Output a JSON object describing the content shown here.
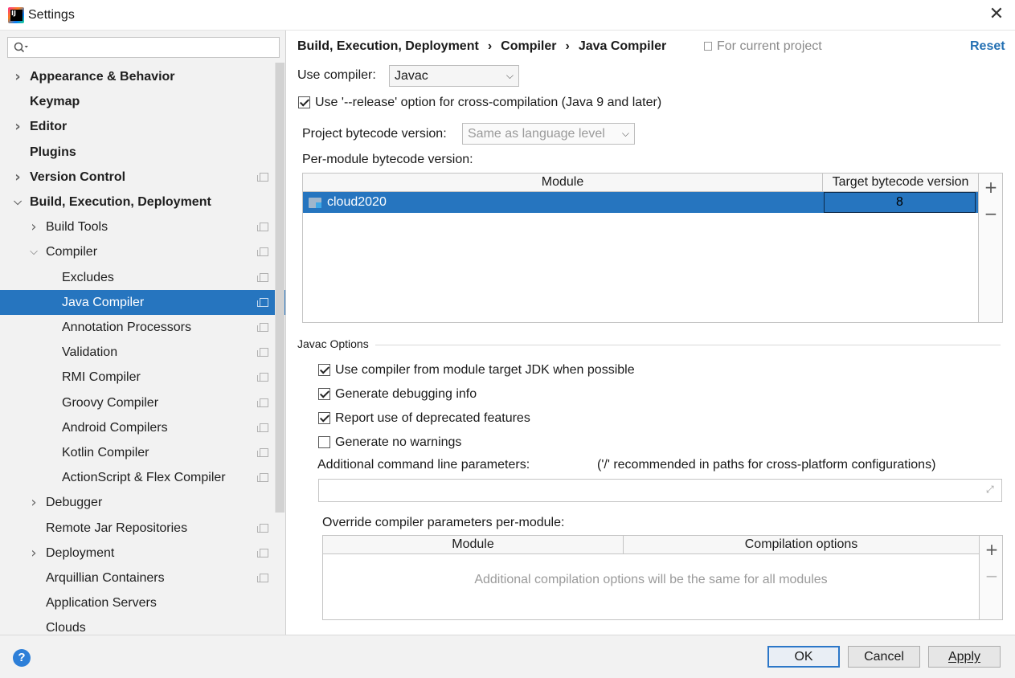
{
  "window": {
    "title": "Settings",
    "close": "✕"
  },
  "search": {
    "placeholder": ""
  },
  "sidebar": {
    "items": [
      {
        "label": "Appearance & Behavior",
        "bold": true,
        "chevron": "right",
        "level": 0,
        "copy": false,
        "selected": false
      },
      {
        "label": "Keymap",
        "bold": true,
        "chevron": "",
        "level": 0,
        "copy": false,
        "selected": false
      },
      {
        "label": "Editor",
        "bold": true,
        "chevron": "right",
        "level": 0,
        "copy": false,
        "selected": false
      },
      {
        "label": "Plugins",
        "bold": true,
        "chevron": "",
        "level": 0,
        "copy": false,
        "selected": false
      },
      {
        "label": "Version Control",
        "bold": true,
        "chevron": "right",
        "level": 0,
        "copy": true,
        "selected": false
      },
      {
        "label": "Build, Execution, Deployment",
        "bold": true,
        "chevron": "down",
        "level": 0,
        "copy": false,
        "selected": false
      },
      {
        "label": "Build Tools",
        "bold": false,
        "chevron": "right",
        "level": 1,
        "copy": true,
        "selected": false
      },
      {
        "label": "Compiler",
        "bold": false,
        "chevron": "down",
        "level": 1,
        "copy": true,
        "selected": false
      },
      {
        "label": "Excludes",
        "bold": false,
        "chevron": "",
        "level": 2,
        "copy": true,
        "selected": false
      },
      {
        "label": "Java Compiler",
        "bold": false,
        "chevron": "",
        "level": 2,
        "copy": true,
        "selected": true
      },
      {
        "label": "Annotation Processors",
        "bold": false,
        "chevron": "",
        "level": 2,
        "copy": true,
        "selected": false
      },
      {
        "label": "Validation",
        "bold": false,
        "chevron": "",
        "level": 2,
        "copy": true,
        "selected": false
      },
      {
        "label": "RMI Compiler",
        "bold": false,
        "chevron": "",
        "level": 2,
        "copy": true,
        "selected": false
      },
      {
        "label": "Groovy Compiler",
        "bold": false,
        "chevron": "",
        "level": 2,
        "copy": true,
        "selected": false
      },
      {
        "label": "Android Compilers",
        "bold": false,
        "chevron": "",
        "level": 2,
        "copy": true,
        "selected": false
      },
      {
        "label": "Kotlin Compiler",
        "bold": false,
        "chevron": "",
        "level": 2,
        "copy": true,
        "selected": false
      },
      {
        "label": "ActionScript & Flex Compiler",
        "bold": false,
        "chevron": "",
        "level": 2,
        "copy": true,
        "selected": false
      },
      {
        "label": "Debugger",
        "bold": false,
        "chevron": "right",
        "level": 1,
        "copy": false,
        "selected": false
      },
      {
        "label": "Remote Jar Repositories",
        "bold": false,
        "chevron": "",
        "level": 1,
        "copy": true,
        "selected": false
      },
      {
        "label": "Deployment",
        "bold": false,
        "chevron": "right",
        "level": 1,
        "copy": true,
        "selected": false
      },
      {
        "label": "Arquillian Containers",
        "bold": false,
        "chevron": "",
        "level": 1,
        "copy": true,
        "selected": false
      },
      {
        "label": "Application Servers",
        "bold": false,
        "chevron": "",
        "level": 1,
        "copy": false,
        "selected": false
      },
      {
        "label": "Clouds",
        "bold": false,
        "chevron": "",
        "level": 1,
        "copy": false,
        "selected": false
      }
    ]
  },
  "header": {
    "breadcrumb": [
      "Build, Execution, Deployment",
      "Compiler",
      "Java Compiler"
    ],
    "separator": "›",
    "for_project": "For current project",
    "reset": "Reset"
  },
  "compiler": {
    "use_compiler_label": "Use compiler:",
    "use_compiler_value": "Javac",
    "release_option": {
      "label": "Use '--release' option for cross-compilation (Java 9 and later)",
      "checked": true
    },
    "project_bytecode_label": "Project bytecode version:",
    "project_bytecode_value": "Same as language level",
    "per_module_label": "Per-module bytecode version:",
    "module_table": {
      "columns": [
        "Module",
        "Target bytecode version"
      ],
      "rows": [
        {
          "module": "cloud2020",
          "version": "8"
        }
      ]
    },
    "add": "+",
    "remove": "−"
  },
  "javac": {
    "title": "Javac Options",
    "options": [
      {
        "label": "Use compiler from module target JDK when possible",
        "checked": true
      },
      {
        "label": "Generate debugging info",
        "checked": true
      },
      {
        "label": "Report use of deprecated features",
        "checked": true
      },
      {
        "label": "Generate no warnings",
        "checked": false
      }
    ],
    "cmdline_label": "Additional command line parameters:",
    "cmdline_hint": "('/' recommended in paths for cross-platform configurations)",
    "cmdline_value": "",
    "override_label": "Override compiler parameters per-module:",
    "override_table": {
      "columns": [
        "Module",
        "Compilation options"
      ],
      "empty_text": "Additional compilation options will be the same for all modules"
    }
  },
  "footer": {
    "help": "?",
    "ok": "OK",
    "cancel": "Cancel",
    "apply": "Apply"
  },
  "colors": {
    "selection": "#2675bf",
    "link": "#2470b3",
    "primary_border": "#2c77c8"
  }
}
